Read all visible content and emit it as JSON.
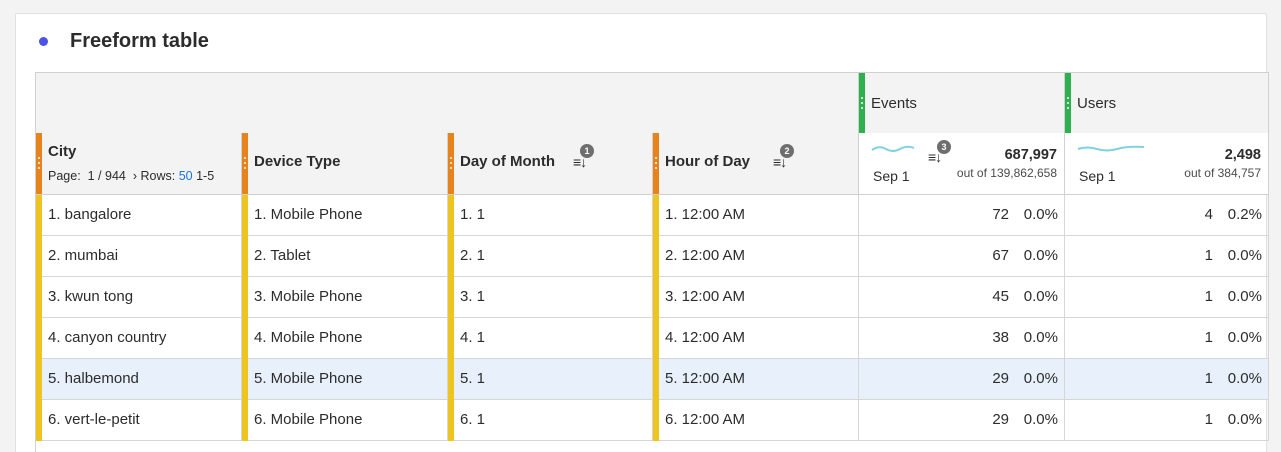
{
  "panel": {
    "title": "Freeform table",
    "accent": "#4b52e8"
  },
  "metrics": [
    {
      "label": "Events",
      "total": "687,997",
      "out_of": "out of 139,862,658",
      "date": "Sep 1",
      "sort_badge": "3"
    },
    {
      "label": "Users",
      "total": "2,498",
      "out_of": "out of 384,757",
      "date": "Sep 1"
    }
  ],
  "dimensions": [
    {
      "label": "City"
    },
    {
      "label": "Device Type"
    },
    {
      "label": "Day of Month",
      "sort_badge": "1"
    },
    {
      "label": "Hour of Day",
      "sort_badge": "2"
    }
  ],
  "pager": {
    "page_prefix": "Page:",
    "page": "1 / 944",
    "rows_label": "Rows:",
    "rows_value": "50",
    "range": "1-5"
  },
  "rows": [
    {
      "city": "1.  bangalore",
      "device": "1.  Mobile Phone",
      "day": "1.  1",
      "hour": "1.  12:00 AM",
      "events": "72",
      "events_pct": "0.0%",
      "users": "4",
      "users_pct": "0.2%"
    },
    {
      "city": "2.  mumbai",
      "device": "2.  Tablet",
      "day": "2.  1",
      "hour": "2.  12:00 AM",
      "events": "67",
      "events_pct": "0.0%",
      "users": "1",
      "users_pct": "0.0%"
    },
    {
      "city": "3.  kwun tong",
      "device": "3.  Mobile Phone",
      "day": "3.  1",
      "hour": "3.  12:00 AM",
      "events": "45",
      "events_pct": "0.0%",
      "users": "1",
      "users_pct": "0.0%"
    },
    {
      "city": "4.  canyon country",
      "device": "4.  Mobile Phone",
      "day": "4.  1",
      "hour": "4.  12:00 AM",
      "events": "38",
      "events_pct": "0.0%",
      "users": "1",
      "users_pct": "0.0%"
    },
    {
      "city": "5.  halbemond",
      "device": "5.  Mobile Phone",
      "day": "5.  1",
      "hour": "5.  12:00 AM",
      "events": "29",
      "events_pct": "0.0%",
      "users": "1",
      "users_pct": "0.0%"
    },
    {
      "city": "6.  vert-le-petit",
      "device": "6.  Mobile Phone",
      "day": "6.  1",
      "hour": "6.  12:00 AM",
      "events": "29",
      "events_pct": "0.0%",
      "users": "1",
      "users_pct": "0.0%"
    }
  ],
  "sort_icon_glyph": "≡↓",
  "sparkline_color": "#7fd3e0",
  "selected_row_color": "#e8f0fb"
}
